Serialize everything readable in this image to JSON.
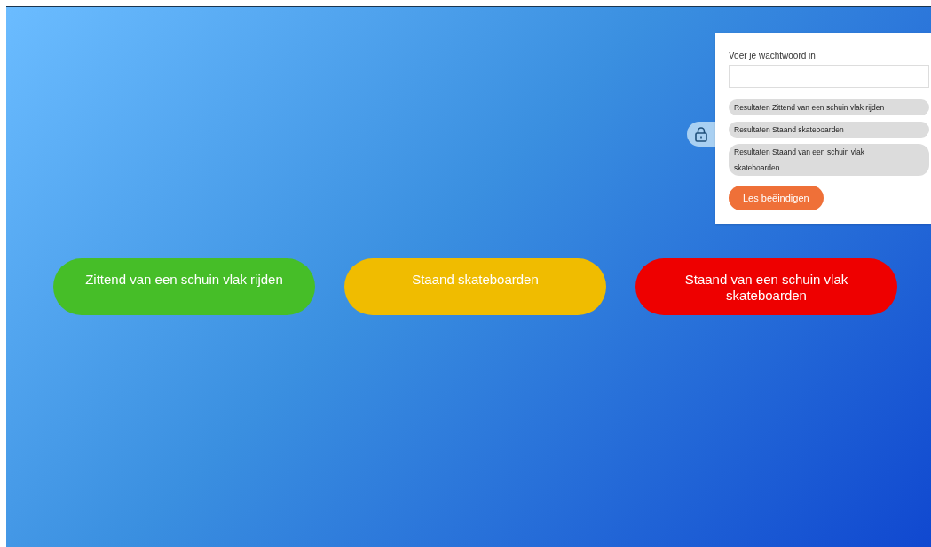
{
  "panel": {
    "password_label": "Voer je wachtwoord in",
    "results": [
      "Resultaten Zittend van een schuin vlak rijden",
      "Resultaten Staand skateboarden",
      "Resultaten Staand van een schuin vlak skateboarden"
    ],
    "end_button": "Les beëindigen"
  },
  "lessons": [
    {
      "label": "Zittend van een schuin vlak rijden",
      "color": "#46be28"
    },
    {
      "label": "Staand skateboarden",
      "color": "#f0bc00"
    },
    {
      "label": "Staand van een schuin vlak skateboarden",
      "color": "#ee0000"
    }
  ]
}
